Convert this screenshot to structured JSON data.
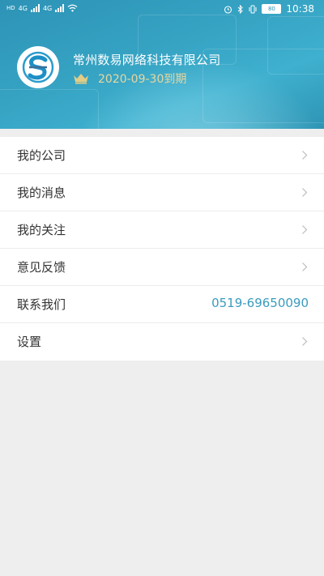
{
  "status_bar": {
    "left_labels": [
      "HD",
      "4G",
      "4G"
    ],
    "battery": "80",
    "time": "10:38"
  },
  "profile": {
    "company_name": "常州数易网络科技有限公司",
    "expire_text": "2020-09-30到期",
    "logo_icon": "company-logo-icon",
    "crown_icon": "crown-icon"
  },
  "menu": {
    "items": [
      {
        "label": "我的公司",
        "trailing": "chevron"
      },
      {
        "label": "我的消息",
        "trailing": "chevron"
      },
      {
        "label": "我的关注",
        "trailing": "chevron"
      },
      {
        "label": "意见反馈",
        "trailing": "chevron"
      },
      {
        "label": "联系我们",
        "value": "0519-69650090"
      },
      {
        "label": "设置",
        "trailing": "chevron"
      }
    ]
  },
  "colors": {
    "header_blue": "#37a4c4",
    "phone_text": "#3a9bbe",
    "expire_gold": "#e7d7a0",
    "page_bg": "#eeeeee"
  }
}
